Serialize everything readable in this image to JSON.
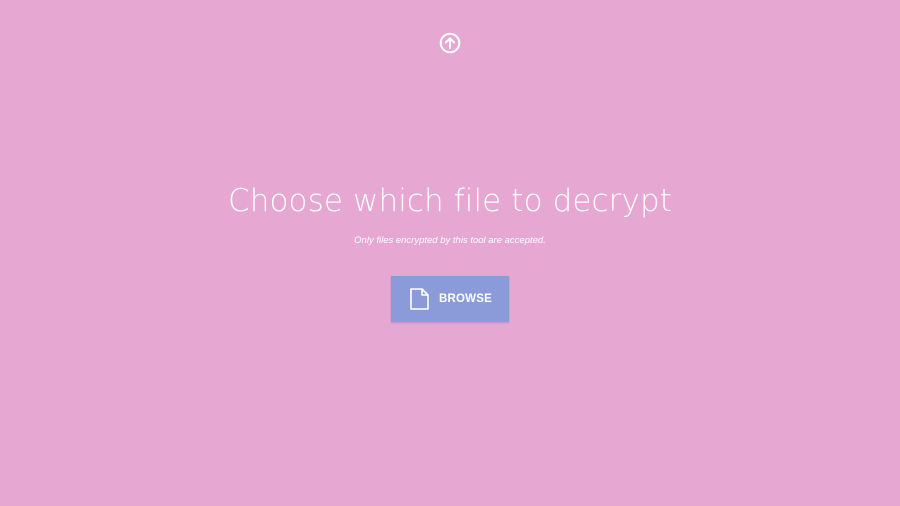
{
  "page": {
    "background_color": "#e6a8d3",
    "accent_color": "#8b9ad9",
    "text_color": "#ffffff"
  },
  "nav": {
    "back_icon": "circle-arrow-up-icon"
  },
  "main": {
    "title": "Choose which file to decrypt",
    "subtitle": "Only files encrypted by this tool are accepted.",
    "browse_button": {
      "label": "BROWSE",
      "icon": "file-icon"
    }
  }
}
